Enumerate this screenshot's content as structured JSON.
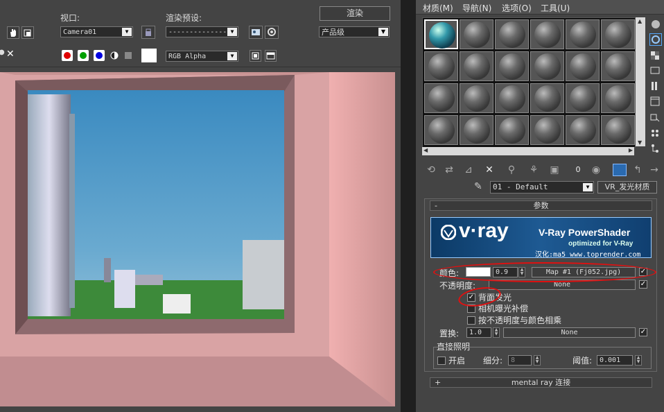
{
  "render_frame": {
    "viewport_label": "视口:",
    "viewport_value": "Camera01",
    "preset_label": "渲染预设:",
    "preset_value": "----------------",
    "render_button": "渲染",
    "quality_value": "产品级",
    "channel_value": "RGB Alpha",
    "colors": {
      "red": "#e00000",
      "green": "#00a000",
      "blue": "#0000e0"
    }
  },
  "material_editor": {
    "menu": [
      "材质(M)",
      "导航(N)",
      "选项(O)",
      "工具(U)"
    ],
    "material_name": "01 - Default",
    "material_type": "VR_发光材质",
    "rollout_params": "参数",
    "banner": {
      "logo": "v·ray",
      "title": "V-Ray PowerShader",
      "subtitle": "optimized for V-Ray",
      "credit": "汉化:ma5 www.toprender.com"
    },
    "color_label": "颜色:",
    "color_value": "0.9",
    "color_map": "Map #1 (Fj052.jpg)",
    "opacity_label": "不透明度:",
    "opacity_map": "None",
    "backside_label": "背面发光",
    "backside_checked": true,
    "camera_exposure_label": "相机曝光补偿",
    "multiply_opacity_label": "按不透明度与颜色相乘",
    "displace_label": "置换:",
    "displace_value": "1.0",
    "displace_map": "None",
    "direct_lighting_label": "直接照明",
    "on_label": "开启",
    "subdiv_label": "细分:",
    "subdiv_value": "8",
    "threshold_label": "阈值:",
    "threshold_value": "0.001",
    "mental_ray_label": "mental ray 连接",
    "rollout_minus": "-",
    "rollout_plus": "+"
  }
}
